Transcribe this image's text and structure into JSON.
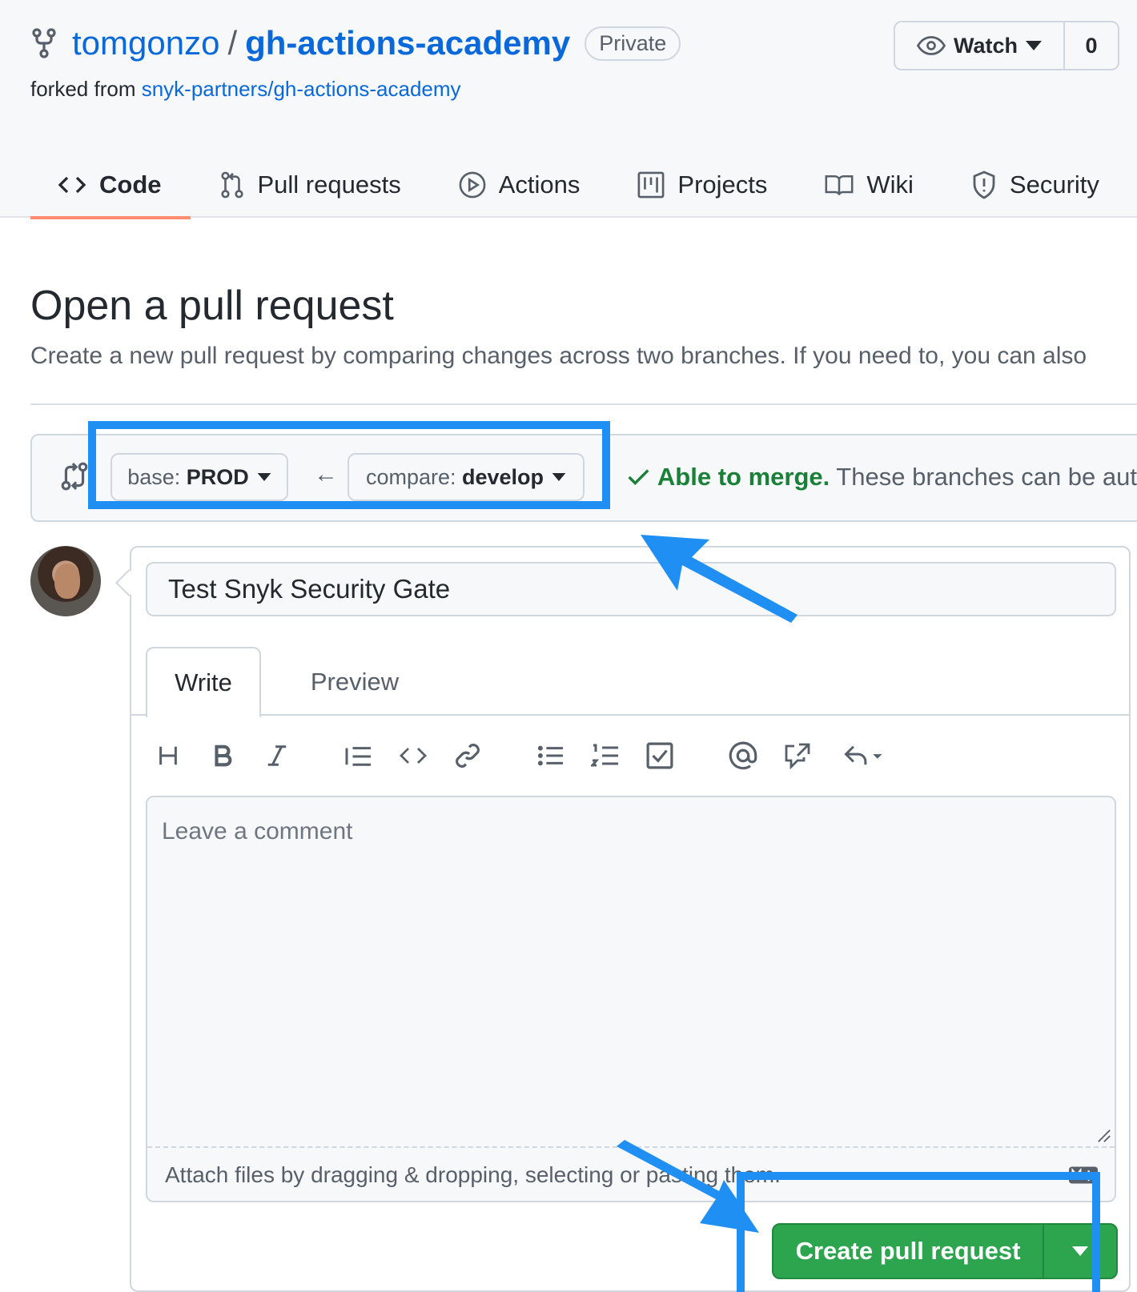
{
  "repo": {
    "owner": "tomgonzo",
    "separator": "/",
    "name": "gh-actions-academy",
    "visibility": "Private",
    "forked_prefix": "forked from ",
    "forked_from": "snyk-partners/gh-actions-academy"
  },
  "watch": {
    "label": "Watch",
    "count": "0"
  },
  "tabs": [
    {
      "label": "Code",
      "icon": "code-icon",
      "active": true
    },
    {
      "label": "Pull requests",
      "icon": "pull-request-icon"
    },
    {
      "label": "Actions",
      "icon": "play-icon"
    },
    {
      "label": "Projects",
      "icon": "project-icon"
    },
    {
      "label": "Wiki",
      "icon": "book-icon"
    },
    {
      "label": "Security",
      "icon": "shield-icon"
    }
  ],
  "page": {
    "title": "Open a pull request",
    "subtitle": "Create a new pull request by comparing changes across two branches. If you need to, you can also"
  },
  "compare": {
    "base_prefix": "base: ",
    "base_branch": "PROD",
    "compare_prefix": "compare: ",
    "compare_branch": "develop",
    "arrow": "←",
    "merge_ok": "Able to merge.",
    "merge_text": " These branches can be aut"
  },
  "form": {
    "title_value": "Test Snyk Security Gate",
    "write_tab": "Write",
    "preview_tab": "Preview",
    "comment_placeholder": "Leave a comment",
    "attach_text": "Attach files by dragging & dropping, selecting or pasting them.",
    "markdown_badge": "MD",
    "submit_label": "Create pull request"
  },
  "toolbar_icons": [
    "heading-icon",
    "bold-icon",
    "italic-icon",
    "quote-icon",
    "code-icon",
    "link-icon",
    "unordered-list-icon",
    "ordered-list-icon",
    "task-list-icon",
    "mention-icon",
    "cross-reference-icon",
    "saved-reply-icon"
  ],
  "colors": {
    "link": "#0969da",
    "success": "#1a7f37",
    "primary_button": "#2da44e",
    "annotation": "#1f8ff3",
    "active_tab_underline": "#fd8c73"
  }
}
